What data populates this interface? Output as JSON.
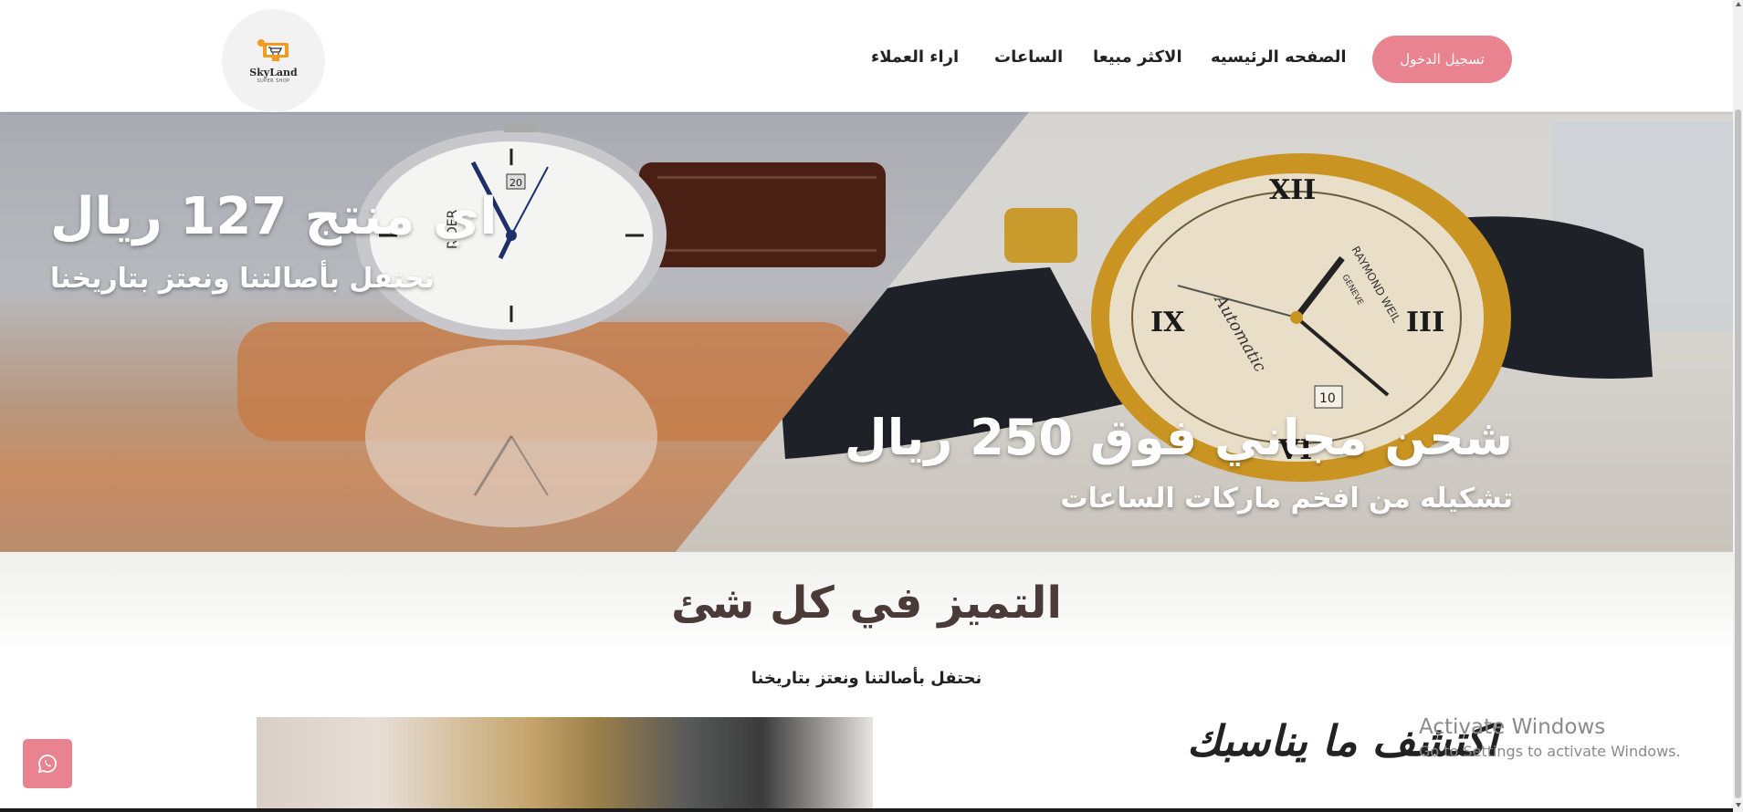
{
  "header": {
    "logo": {
      "name": "SkyLand",
      "sub": "SUPER SHOP"
    },
    "nav": {
      "home": "الصفحه الرئيسيه",
      "best_selling": "الاكثر مبيعا",
      "watches": "الساعات",
      "reviews": "اراء العملاء"
    },
    "login_label": "تسجيل الدخول"
  },
  "hero": {
    "left_title": "اي منتج 127 ريال",
    "left_subtitle": "نحتفل بأصالتنا ونعتز بتاريخنا",
    "right_title": "شحن مجاني فوق 250 ريال",
    "right_subtitle": "تشكيله من افخم ماركات الساعات",
    "left_watch_brand": "RIDER",
    "right_watch_brand": "RAYMOND WEIL",
    "right_watch_city": "GENEVE",
    "right_watch_script": "Automatic",
    "left_watch_date": "20",
    "right_watch_date": "10"
  },
  "section": {
    "title": "التميز في كل شئ",
    "subtitle": "نحتفل بأصالتنا ونعتز بتاريخنا",
    "discover": "اكتشف ما يناسبك"
  },
  "activate": {
    "line1": "Activate Windows",
    "line2": "Go to Settings to activate Windows."
  },
  "colors": {
    "accent": "#e8838f",
    "title": "#4a3b38"
  },
  "icons": {
    "whatsapp": "whatsapp-icon",
    "cart": "cart-icon"
  }
}
